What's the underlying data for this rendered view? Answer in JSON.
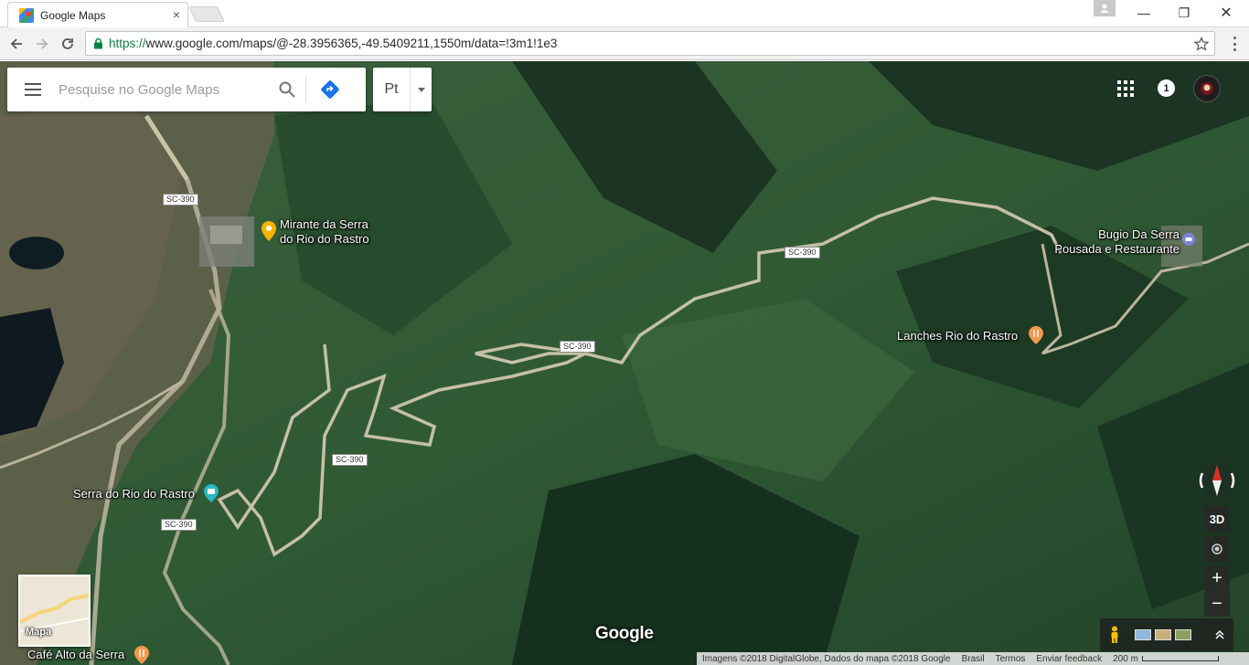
{
  "browser": {
    "tab_title": "Google Maps",
    "close_tab_glyph": "×",
    "url_scheme": "https://",
    "url_rest": "www.google.com/maps/@-28.3956365,-49.5409211,1550m/data=!3m1!1e3"
  },
  "window_controls": {
    "minimize": "—",
    "restore": "❐",
    "close": "✕"
  },
  "search": {
    "placeholder": "Pesquise no Google Maps"
  },
  "language": {
    "label": "Pt"
  },
  "header": {
    "notification_count": "1"
  },
  "places": {
    "mirante": [
      "Mirante da Serra",
      "do Rio do Rastro"
    ],
    "bugio": [
      "Bugio Da Serra",
      "Pousada e Restaurante"
    ],
    "lanches": "Lanches Rio do Rastro",
    "serra": "Serra do Rio do Rastro",
    "cafe": "Café Alto da Serra"
  },
  "road_labels": {
    "sc390": "SC-390"
  },
  "controls": {
    "tilt_label": "3D",
    "zoom_in": "+",
    "zoom_out": "−",
    "expand_glyph": "⌃"
  },
  "minimap": {
    "label": "Mapa"
  },
  "branding": {
    "logo_text": "Google"
  },
  "footer": {
    "attribution": "Imagens ©2018 DigitalGlobe, Dados do mapa ©2018 Google",
    "country": "Brasil",
    "terms": "Termos",
    "feedback": "Enviar feedback",
    "scale": "200 m"
  },
  "colors": {
    "accent_blue": "#1a73e8",
    "pin_yellow": "#f4b400",
    "pin_orange": "#f29a4a",
    "pin_teal": "#29b6c6",
    "pin_purple": "#7c84d8"
  }
}
